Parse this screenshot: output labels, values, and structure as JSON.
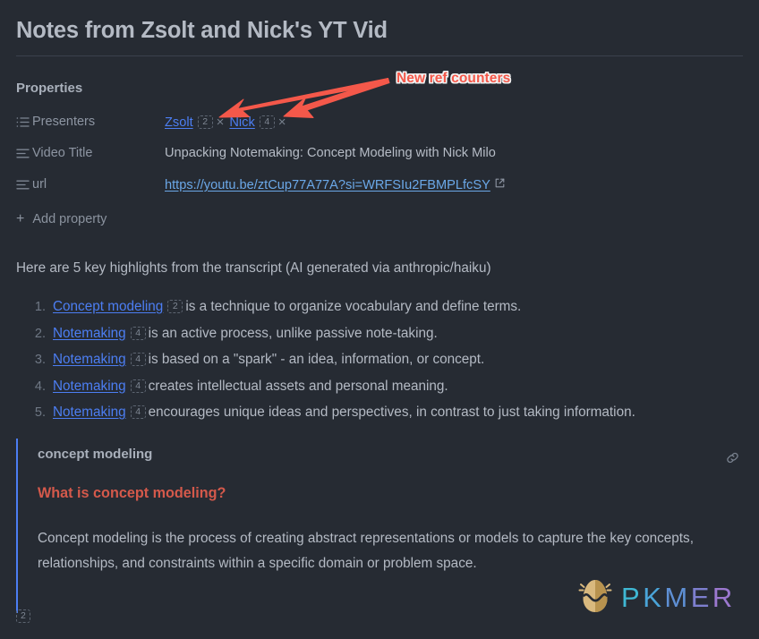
{
  "note": {
    "title": "Notes from Zsolt and Nick's YT Vid"
  },
  "properties": {
    "heading": "Properties",
    "add_property_label": "Add property",
    "add_property_plus": "+",
    "rows": [
      {
        "icon": "list-icon",
        "label": "Presenters",
        "type": "tags",
        "tags": [
          {
            "text": "Zsolt",
            "ref_count": "2",
            "remove": "×"
          },
          {
            "text": "Nick",
            "ref_count": "4",
            "remove": "×"
          }
        ]
      },
      {
        "icon": "align-left-icon",
        "label": "Video Title",
        "type": "text",
        "value": "Unpacking Notemaking: Concept Modeling with Nick Milo"
      },
      {
        "icon": "align-left-icon",
        "label": "url",
        "type": "link",
        "value": "https://youtu.be/ztCup77A77A?si=WRFSIu2FBMPLfcSY"
      }
    ]
  },
  "body": {
    "intro": "Here are 5 key highlights from the transcript (AI generated via anthropic/haiku)",
    "highlights": [
      {
        "num": "1.",
        "link": "Concept modeling",
        "ref_count": "2",
        "text": "is a technique to organize vocabulary and define terms."
      },
      {
        "num": "2.",
        "link": "Notemaking",
        "ref_count": "4",
        "text": "is an active process, unlike passive note-taking."
      },
      {
        "num": "3.",
        "link": "Notemaking",
        "ref_count": "4",
        "text": "is based on a \"spark\" - an idea, information, or concept."
      },
      {
        "num": "4.",
        "link": "Notemaking",
        "ref_count": "4",
        "text": "creates intellectual assets and personal meaning."
      },
      {
        "num": "5.",
        "link": "Notemaking",
        "ref_count": "4",
        "text": "encourages unique ideas and perspectives, in contrast to just taking information."
      }
    ]
  },
  "embed": {
    "title": "concept modeling",
    "heading": "What is concept modeling?",
    "paragraph": "Concept modeling is the process of creating abstract representations or models to capture the key concepts, relationships, and constraints within a specific domain or problem space.",
    "link_icon": "link-icon",
    "footer_ref_count": "2"
  },
  "annotation": {
    "label": "New ref counters",
    "color": "#f4584a"
  },
  "watermark": {
    "letters": [
      {
        "char": "P",
        "color": "#3fb8d4"
      },
      {
        "char": "K",
        "color": "#4aa4d8"
      },
      {
        "char": "M",
        "color": "#5e8fd4"
      },
      {
        "char": "E",
        "color": "#7d7fcf"
      },
      {
        "char": "R",
        "color": "#9b78cf"
      }
    ],
    "egg_colors": {
      "light": "#d9b97e",
      "dark": "#b8934f"
    }
  },
  "theme": {
    "background": "#262b33",
    "text": "#b4bac4",
    "muted": "#8d95a2",
    "accent_blue": "#4c7ef3",
    "link_blue": "#6ba8e8",
    "embed_heading": "#d4594b"
  }
}
